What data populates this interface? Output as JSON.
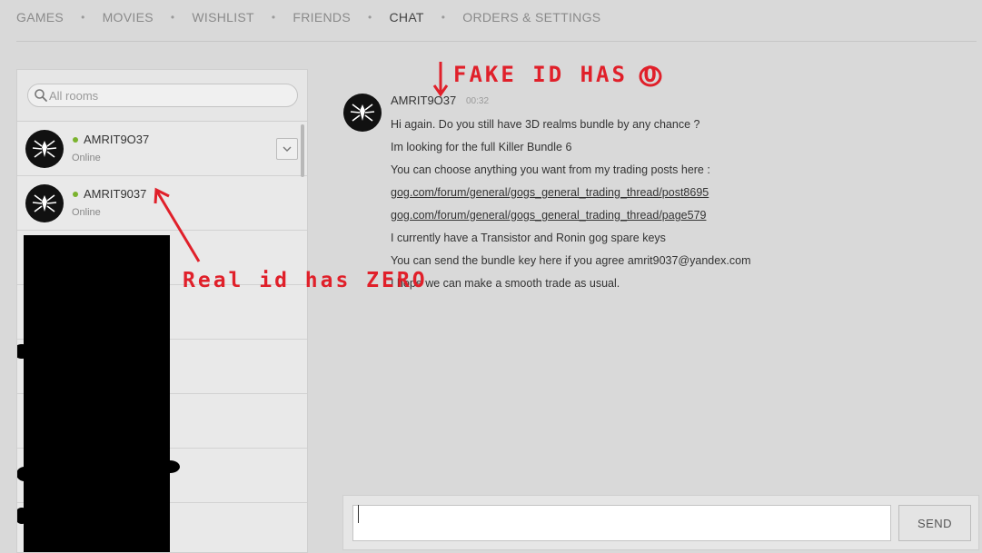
{
  "nav": {
    "items": [
      {
        "label": "GAMES"
      },
      {
        "label": "MOVIES"
      },
      {
        "label": "WISHLIST"
      },
      {
        "label": "FRIENDS"
      },
      {
        "label": "CHAT",
        "active": true
      },
      {
        "label": "ORDERS & SETTINGS"
      }
    ],
    "separator": "•"
  },
  "rooms": {
    "search_placeholder": "All rooms",
    "items": [
      {
        "name": "AMRIT9O37",
        "status": "Online",
        "icon": "spider-avatar-icon"
      },
      {
        "name": "AMRIT9037",
        "status": "Online",
        "icon": "spider-avatar-icon"
      }
    ]
  },
  "chat": {
    "author": "AMRIT9O37",
    "time": "00:32",
    "lines": [
      {
        "text": "Hi again. Do you still have 3D realms bundle by any chance ?",
        "link": false
      },
      {
        "text": "Im looking for the full Killer Bundle 6",
        "link": false
      },
      {
        "text": "You can choose anything you want from my trading posts here :",
        "link": false
      },
      {
        "text": "gog.com/forum/general/gogs_general_trading_thread/post8695",
        "link": true
      },
      {
        "text": "gog.com/forum/general/gogs_general_trading_thread/page579",
        "link": true
      },
      {
        "text": "I currently have a Transistor and Ronin gog spare keys",
        "link": false
      },
      {
        "text": "You can send the bundle key here if you agree amrit9037@yandex.com",
        "link": false
      },
      {
        "text": "I hope we can make a smooth trade as usual.",
        "link": false
      }
    ]
  },
  "composer": {
    "send_label": "SEND"
  },
  "annotations": {
    "fake": "FAKE ID HAS O",
    "real": "Real id has ZERO",
    "color": "#e0202a"
  },
  "colors": {
    "online": "#7bb32e",
    "background": "#d9d9d9"
  }
}
